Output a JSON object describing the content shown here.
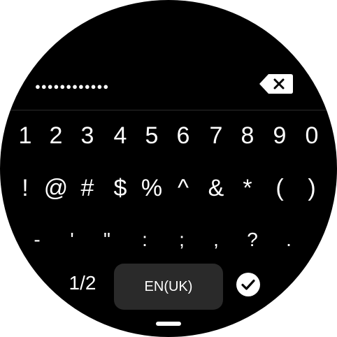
{
  "password_field": {
    "masked_value": "●●●●●●●●●●●●"
  },
  "icons": {
    "backspace": "backspace-icon",
    "confirm": "check-circle-icon"
  },
  "keyboard": {
    "row1": [
      "1",
      "2",
      "3",
      "4",
      "5",
      "6",
      "7",
      "8",
      "9",
      "0"
    ],
    "row2": [
      "!",
      "@",
      "#",
      "$",
      "%",
      "^",
      "&",
      "*",
      "(",
      ")"
    ],
    "row3": [
      "-",
      "'",
      "\"",
      ":",
      ";",
      ",",
      "?",
      "."
    ],
    "page_toggle": "1/2",
    "language": "EN(UK)"
  },
  "colors": {
    "background": "#000000",
    "key_text": "#ffffff",
    "lang_button": "#2a2a2a"
  }
}
